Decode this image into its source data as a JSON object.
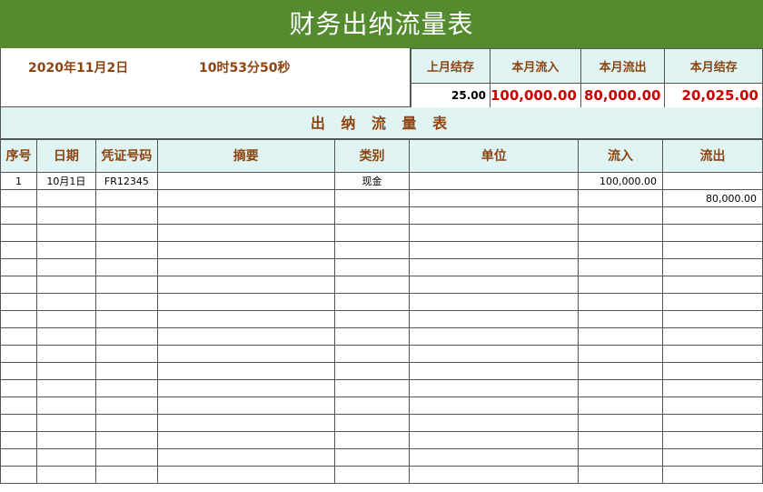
{
  "title": "财务出纳流量表",
  "header": {
    "date": "2020年11月2日",
    "time": "10时53分50秒"
  },
  "summary": {
    "labels": [
      "上月结存",
      "本月流入",
      "本月流出",
      "本月结存"
    ],
    "values": [
      "25.00",
      "100,000.00",
      "80,000.00",
      "20,025.00"
    ]
  },
  "section_title": "出 纳 流 量 表",
  "columns": [
    "序号",
    "日期",
    "凭证号码",
    "摘要",
    "类别",
    "单位",
    "流入",
    "流出"
  ],
  "rows": [
    [
      "1",
      "10月1日",
      "FR12345",
      "",
      "现金",
      "",
      "100,000.00",
      ""
    ],
    [
      "",
      "",
      "",
      "",
      "",
      "",
      "",
      "80,000.00"
    ]
  ]
}
